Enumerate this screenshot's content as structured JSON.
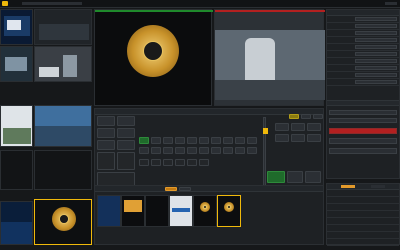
{
  "app": {
    "logo_color": "#f0b90b",
    "title": "",
    "accent": "#f0b90b"
  },
  "monitors": {
    "preview_label": "",
    "program_label": ""
  },
  "colors": {
    "program_red": "#b32020",
    "preview_green": "#1f8a2b",
    "highlight_yellow": "#f0b90b"
  },
  "switcher": {
    "transition_auto_label": "",
    "transition_cut_label": "",
    "tbar_level": 0.15
  },
  "right_panel": {
    "rows": [
      {
        "key": "",
        "value": ""
      },
      {
        "key": "",
        "value": ""
      },
      {
        "key": "",
        "value": ""
      },
      {
        "key": "",
        "value": ""
      },
      {
        "key": "",
        "value": ""
      },
      {
        "key": "",
        "value": ""
      },
      {
        "key": "",
        "value": ""
      },
      {
        "key": "",
        "value": ""
      },
      {
        "key": "",
        "value": ""
      },
      {
        "key": "",
        "value": ""
      }
    ],
    "list_items": [
      "",
      "",
      "",
      "",
      "",
      "",
      "",
      ""
    ]
  },
  "media_bin": {
    "tabs": [
      "",
      "",
      "",
      "",
      "",
      ""
    ],
    "items": [
      "",
      "",
      "",
      "",
      "",
      ""
    ]
  },
  "icons": {
    "logo": "logo-icon",
    "seal": "emblem-icon"
  }
}
